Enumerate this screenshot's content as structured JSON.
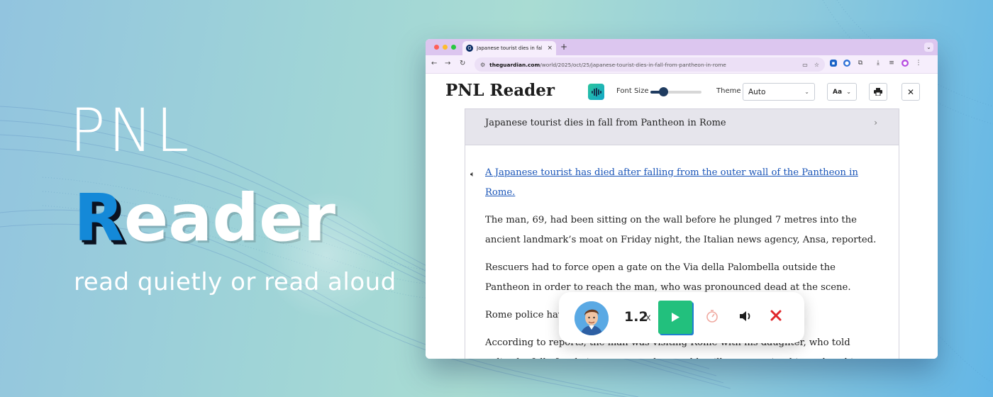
{
  "hero": {
    "title_line1": "PNL",
    "title_first_letter": "R",
    "title_rest": "eader",
    "tagline": "read quietly or read aloud"
  },
  "browser": {
    "tab_title": "Japanese tourist dies in fall fr",
    "tab_close": "×",
    "new_tab": "+",
    "url_host": "theguardian.com",
    "url_path": "/world/2025/oct/25/japanese-tourist-dies-in-fall-from-pantheon-in-rome"
  },
  "reader": {
    "brand": "PNL Reader",
    "font_size_label": "Font Size",
    "font_size_level": 0.25,
    "theme_label": "Theme",
    "theme_value": "Auto",
    "typeface_button": "Aa",
    "article_title": "Japanese tourist dies in fall from Pantheon in Rome",
    "paragraphs": [
      "A Japanese tourist has died after falling from the outer wall of the Pantheon in Rome.",
      "The man, 69, had been sitting on the wall before he plunged 7 metres into the ancient landmark’s moat on Friday night, the Italian news agency, Ansa, reported.",
      "Rescuers had to force open a gate on the Via della Palombella outside the Pantheon in order to reach the man, who was pronounced dead at the scene.",
      "Rome police have opened an investigation.",
      "According to reports, the man was visiting Rome with his daughter, who told police he fell after being overcome by a sudden illness, causing him to lose his balance."
    ]
  },
  "player": {
    "speed_value": "1.2",
    "speed_unit": "x"
  },
  "colors": {
    "accent_blue": "#1489d8",
    "play_green": "#22c07d",
    "stop_red": "#e0262b",
    "tab_strip": "#dcc6ef"
  },
  "icons": [
    "close-icon",
    "plus-icon",
    "back-icon",
    "forward-icon",
    "reload-icon",
    "star-icon",
    "download-icon",
    "print-icon",
    "speaker-icon",
    "play-icon",
    "timer-icon",
    "volume-icon",
    "stop-icon"
  ]
}
